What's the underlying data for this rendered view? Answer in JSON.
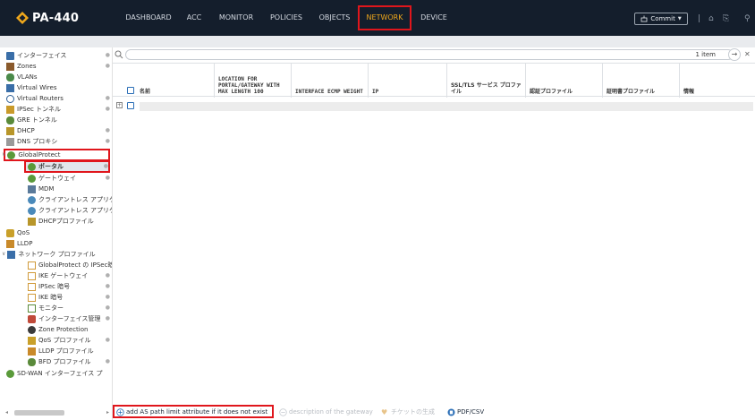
{
  "app": {
    "logo_text": "PA-440"
  },
  "nav": {
    "tabs": [
      "DASHBOARD",
      "ACC",
      "MONITOR",
      "POLICIES",
      "OBJECTS",
      "NETWORK",
      "DEVICE"
    ],
    "active": "NETWORK",
    "commit_label": "Commit"
  },
  "sidebar": {
    "items": [
      {
        "label": "インターフェイス"
      },
      {
        "label": "Zones"
      },
      {
        "label": "VLANs"
      },
      {
        "label": "Virtual Wires"
      },
      {
        "label": "Virtual Routers"
      },
      {
        "label": "IPSec トンネル"
      },
      {
        "label": "GRE トンネル"
      },
      {
        "label": "DHCP"
      },
      {
        "label": "DNS プロキシ"
      },
      {
        "label": "GlobalProtect"
      },
      {
        "label": "ポータル"
      },
      {
        "label": "ゲートウェイ"
      },
      {
        "label": "MDM"
      },
      {
        "label": "クライアントレス アプリケ"
      },
      {
        "label": "クライアントレス アプリケ"
      },
      {
        "label": "DHCPプロファイル"
      },
      {
        "label": "QoS"
      },
      {
        "label": "LLDP"
      },
      {
        "label": "ネットワーク プロファイル"
      },
      {
        "label": "GlobalProtect の IPSec暗"
      },
      {
        "label": "IKE ゲートウェイ"
      },
      {
        "label": "IPSec 暗号"
      },
      {
        "label": "IKE 暗号"
      },
      {
        "label": "モニター"
      },
      {
        "label": "インターフェイス管理"
      },
      {
        "label": "Zone Protection"
      },
      {
        "label": "QoS プロファイル"
      },
      {
        "label": "LLDP プロファイル"
      },
      {
        "label": "BFD プロファイル"
      },
      {
        "label": "SD-WAN インターフェイス プ"
      }
    ]
  },
  "search": {
    "placeholder": "",
    "items_count": "1 item"
  },
  "table": {
    "columns": [
      "名前",
      "LOCATION FOR PORTAL/GATEWAY WITH MAX LENGTH 100",
      "INTERFACE ECMP WEIGHT",
      "IP",
      "SSL/TLS サービス プロファイル",
      "認証プロファイル",
      "証明書プロファイル",
      "情報"
    ]
  },
  "footer": {
    "add_label": "add AS path limit attribute if it does not exist",
    "delete_label": "description of the gateway",
    "clone_label": "チケットの生成",
    "pdf_label": "PDF/CSV"
  }
}
